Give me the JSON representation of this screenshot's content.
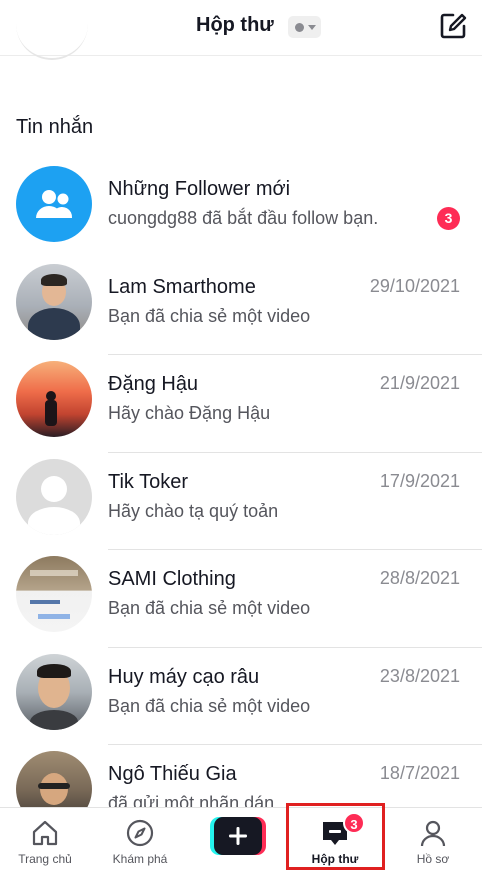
{
  "header": {
    "title": "Hộp thư",
    "status_icon": "status-dot-icon",
    "compose_icon": "compose-icon"
  },
  "section_label": "Tin nhắn",
  "messages": [
    {
      "name": "Những Follower mới",
      "preview": "cuongdg88 đã bắt đầu follow bạn.",
      "date": "",
      "unread": "3",
      "avatar": "followers-group-icon"
    },
    {
      "name": "Lam Smarthome",
      "preview": "Bạn đã chia sẻ một video",
      "date": "29/10/2021",
      "avatar": "user-photo"
    },
    {
      "name": "Đặng Hậu",
      "preview": "Hãy chào Đặng Hậu",
      "date": "21/9/2021",
      "avatar": "user-photo"
    },
    {
      "name": "Tik Toker",
      "preview": "Hãy chào tạ quý toản",
      "date": "17/9/2021",
      "avatar": "default-avatar-icon"
    },
    {
      "name": "SAMI Clothing",
      "preview": "Bạn đã chia sẻ một video",
      "date": "28/8/2021",
      "avatar": "user-photo"
    },
    {
      "name": "Huy máy cạo râu",
      "preview": "Bạn đã chia sẻ một video",
      "date": "23/8/2021",
      "avatar": "user-photo"
    },
    {
      "name": "Ngô Thiếu Gia",
      "preview": "đã gửi một nhãn dán",
      "date": "18/7/2021",
      "avatar": "user-photo"
    }
  ],
  "bottom_nav": {
    "items": [
      {
        "label": "Trang chủ",
        "icon": "home-icon"
      },
      {
        "label": "Khám phá",
        "icon": "compass-icon"
      },
      {
        "label": "",
        "icon": "create-plus-icon"
      },
      {
        "label": "Hộp thư",
        "icon": "inbox-icon",
        "active": true,
        "badge": "3"
      },
      {
        "label": "Hồ sơ",
        "icon": "profile-icon"
      }
    ]
  },
  "colors": {
    "accent": "#fe2c55",
    "followers_avatar": "#1da1f2",
    "active_highlight": "#e02020"
  }
}
